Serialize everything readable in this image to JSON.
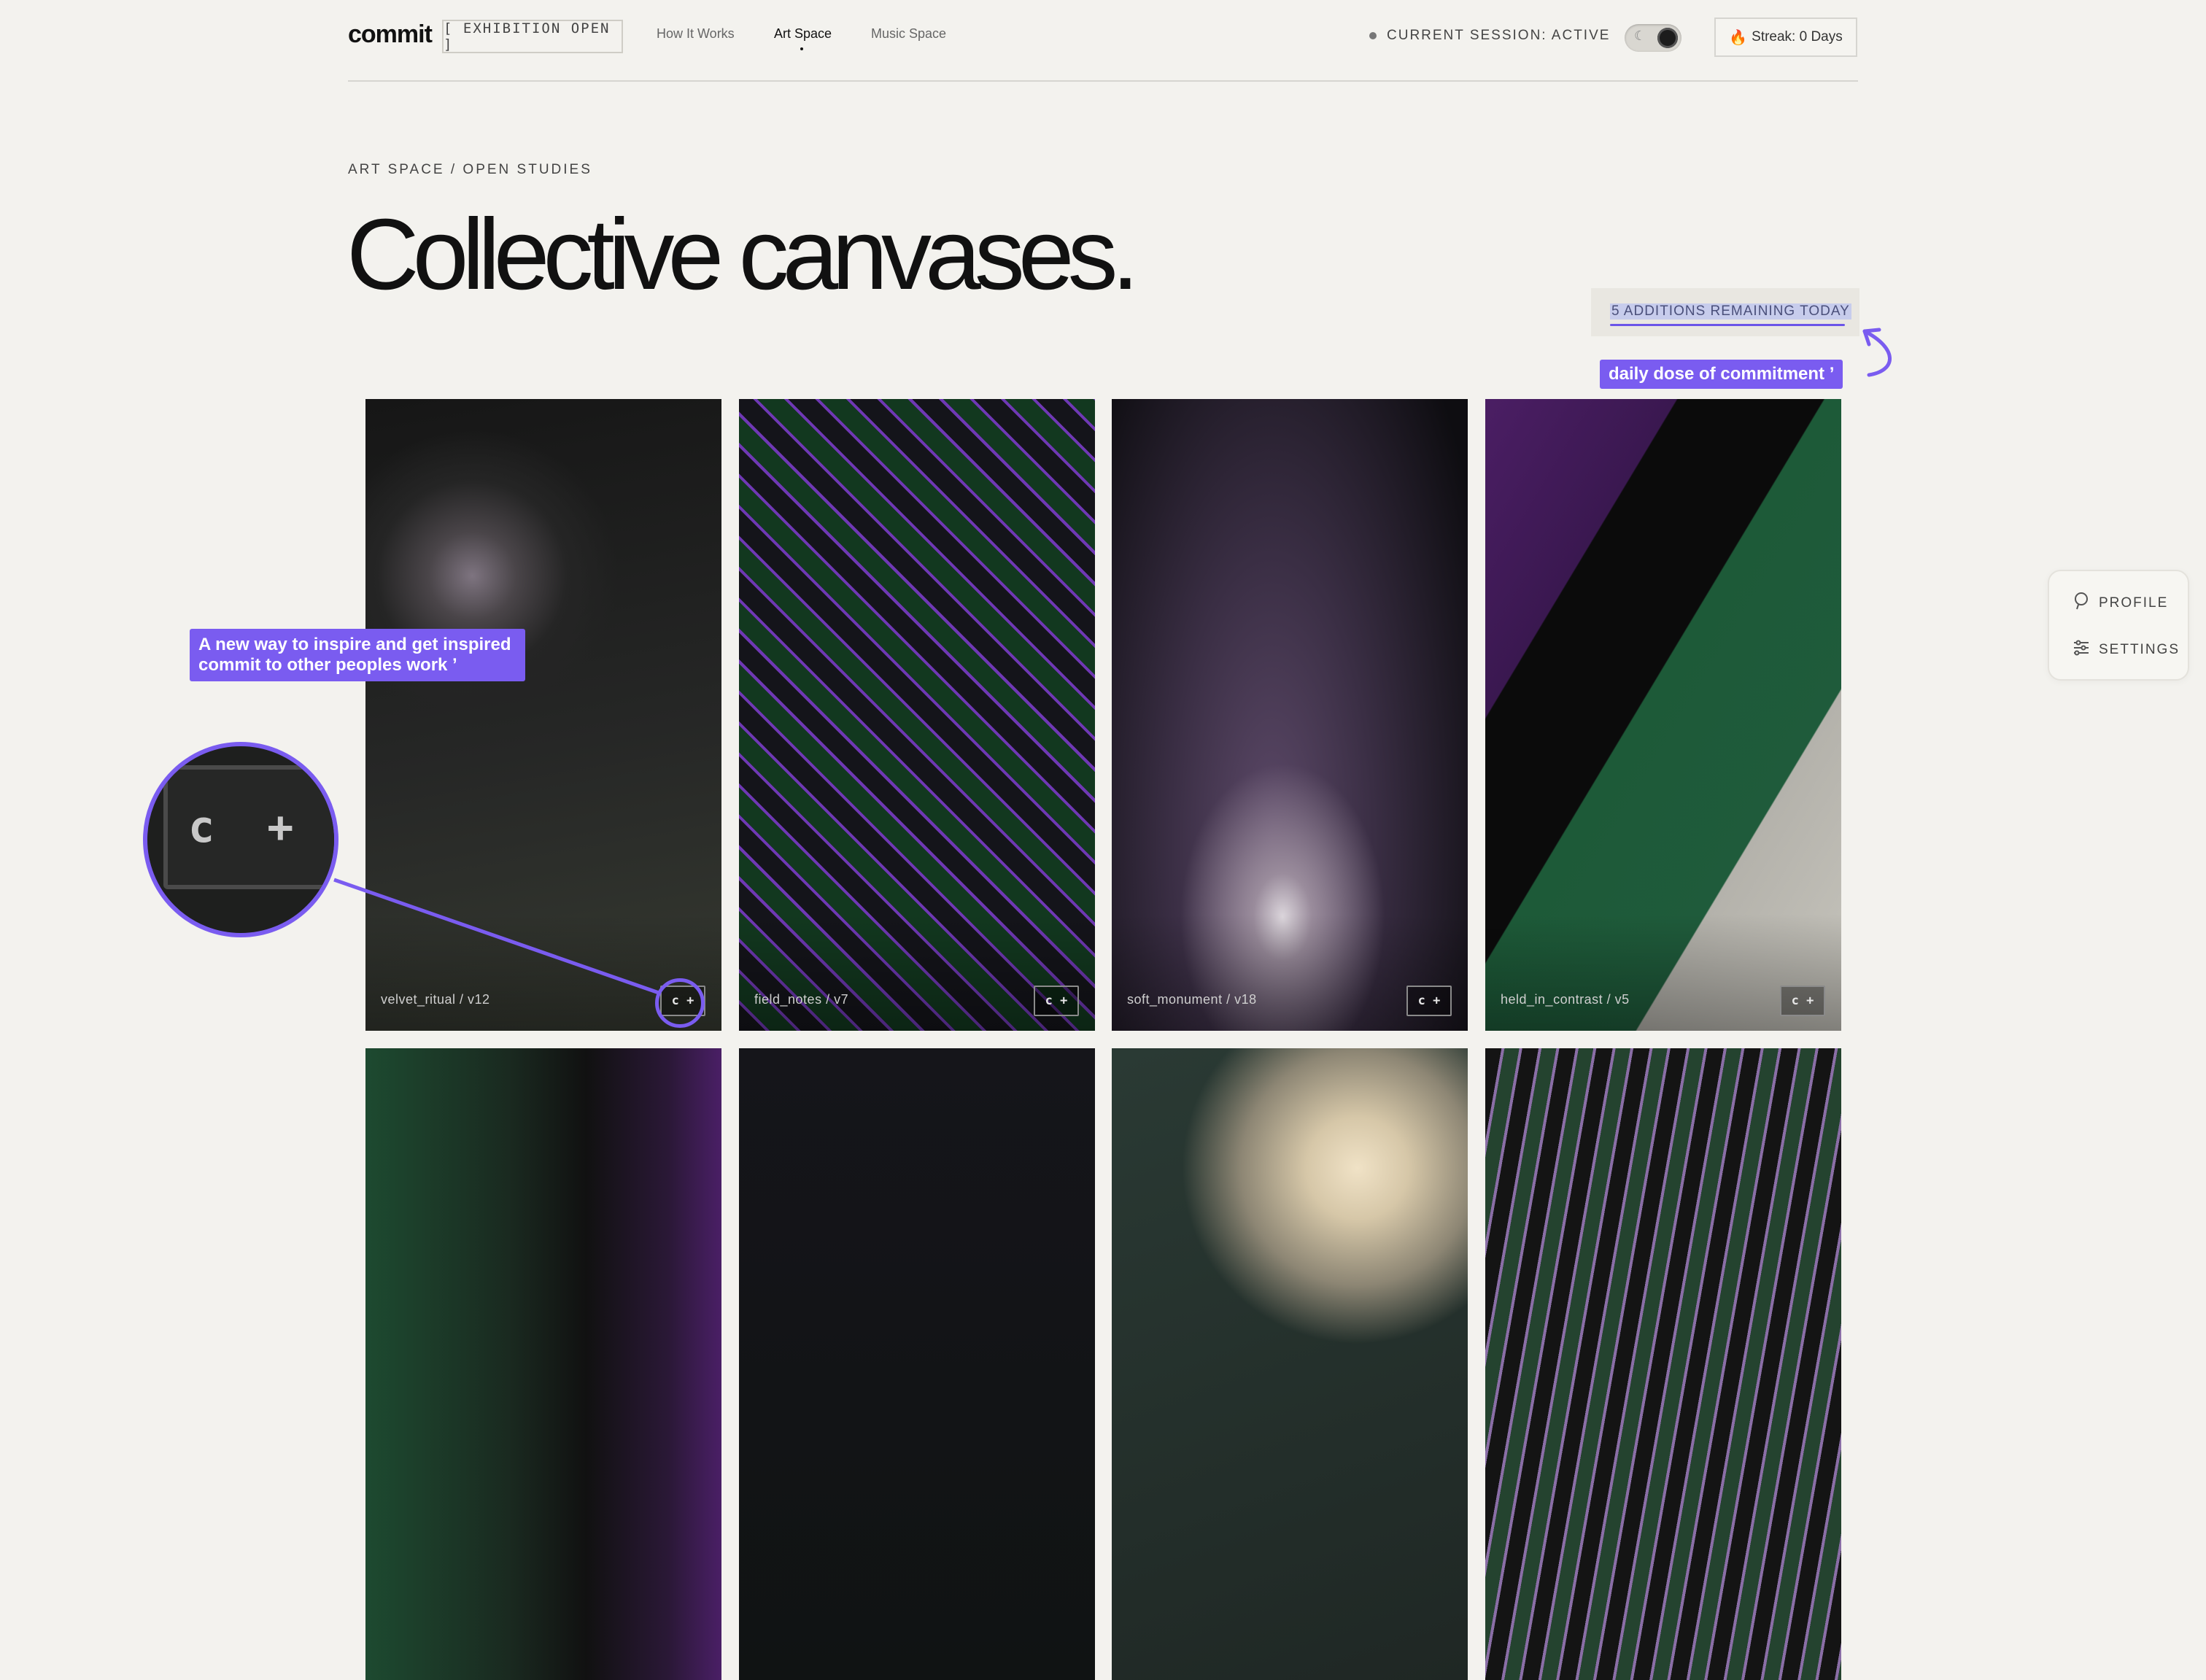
{
  "header": {
    "brand": "commit",
    "status_badge": "[ EXHIBITION OPEN ]",
    "nav": [
      {
        "label": "How It Works",
        "active": false
      },
      {
        "label": "Art Space",
        "active": true
      },
      {
        "label": "Music Space",
        "active": false
      }
    ],
    "session": "CURRENT SESSION: ACTIVE",
    "theme_toggle": {
      "icon": "moon-icon",
      "state": "dark"
    },
    "streak": {
      "icon": "fire-icon",
      "label": "Streak: 0 Days"
    }
  },
  "hero": {
    "breadcrumb": "ART SPACE / OPEN STUDIES",
    "title": "Collective canvases.",
    "remaining": "5 ADDITIONS REMAINING TODAY"
  },
  "annotations": {
    "daily": "daily dose of commitment ʼ",
    "inspire_line1": "A new way to inspire and get inspired",
    "inspire_line2": "commit to other peoples work ʼ",
    "magnified_key": "c +"
  },
  "cards": [
    {
      "label": "velvet_ritual / v12",
      "button": "c +"
    },
    {
      "label": "field_notes / v7",
      "button": "c +"
    },
    {
      "label": "soft_monument / v18",
      "button": "c +"
    },
    {
      "label": "held_in_contrast / v5",
      "button": "c +"
    }
  ],
  "side_menu": [
    {
      "icon": "profile-icon",
      "label": "PROFILE"
    },
    {
      "icon": "settings-icon",
      "label": "SETTINGS"
    }
  ],
  "colors": {
    "background": "#f3f2ee",
    "accent": "#7a5cf0",
    "text": "#1a1a1a"
  }
}
